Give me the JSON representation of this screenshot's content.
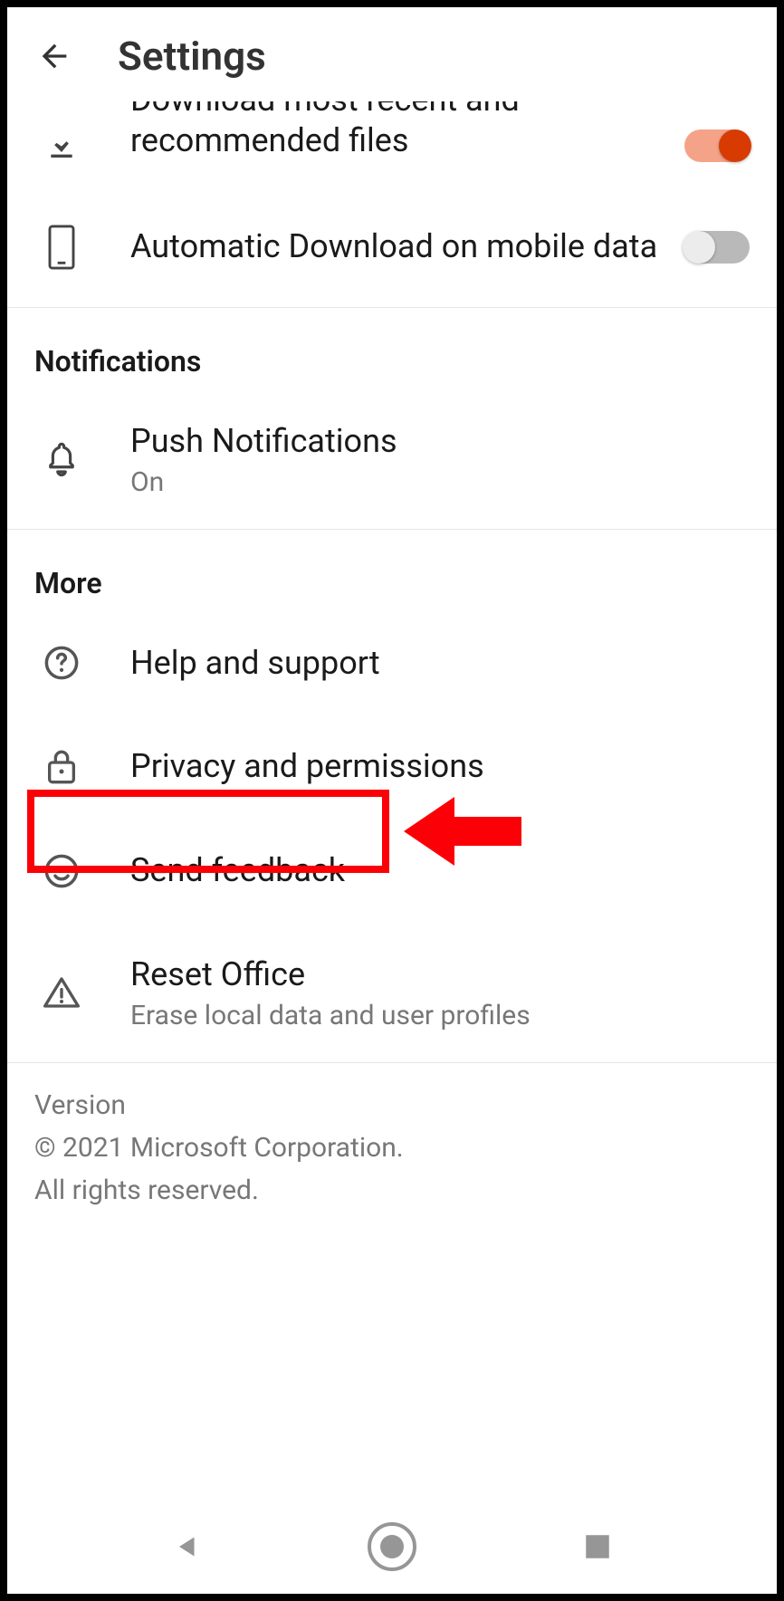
{
  "header": {
    "title": "Settings"
  },
  "downloads": {
    "recent_label_line1": "Download most recent and",
    "recent_label_line2": "recommended files",
    "recent_on": true,
    "mobile_label": "Automatic Download on mobile data",
    "mobile_on": false
  },
  "notifications": {
    "section": "Notifications",
    "push_label": "Push Notifications",
    "push_value": "On"
  },
  "more": {
    "section": "More",
    "help_label": "Help and support",
    "privacy_label": "Privacy and permissions",
    "feedback_label": "Send feedback",
    "reset_label": "Reset Office",
    "reset_sub": "Erase local data and user profiles"
  },
  "footer": {
    "version": "Version",
    "copyright": "© 2021 Microsoft Corporation.",
    "rights": "All rights reserved."
  }
}
